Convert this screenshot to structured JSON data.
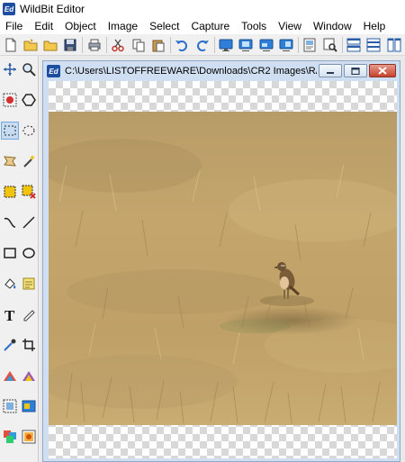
{
  "app": {
    "title": "WildBit Editor",
    "icon_text": "Ed"
  },
  "menu": [
    "File",
    "Edit",
    "Object",
    "Image",
    "Select",
    "Capture",
    "Tools",
    "View",
    "Window",
    "Help"
  ],
  "toolbar": {
    "buttons": [
      "new-icon",
      "open-icon",
      "open-folder-icon",
      "save-icon",
      "print-icon",
      "cut-icon",
      "copy-icon",
      "paste-icon",
      "undo-icon",
      "redo-icon",
      "monitor-icon",
      "monitor-window-icon",
      "monitor-region-icon",
      "monitor-object-icon",
      "properties-icon",
      "preview-icon",
      "tile-horizontal-icon",
      "tile-rows-icon",
      "tile-vertical-icon"
    ]
  },
  "toolbox": {
    "tools": [
      "move-icon",
      "zoom-icon",
      "red-eye-icon",
      "polygon-icon",
      "rect-select-icon",
      "ellipse-select-icon",
      "lasso-icon",
      "magic-wand-icon",
      "crop-select-icon",
      "clear-select-icon",
      "curve-icon",
      "line-icon",
      "rectangle-icon",
      "ellipse-icon",
      "fill-icon",
      "note-icon",
      "text-icon",
      "pencil-icon",
      "eyedropper-icon",
      "crop-icon",
      "adjust-icon",
      "sharpen-icon",
      "capture-region-icon",
      "screenshot-icon",
      "layers-icon",
      "gallery-icon"
    ],
    "selected": "rect-select-icon"
  },
  "document": {
    "title": "C:\\Users\\LISTOFFREEWARE\\Downloads\\CR2 Images\\RA...",
    "icon_text": "Ed"
  },
  "colors": {
    "accent": "#1e4ea0",
    "grass": "#c0a26a",
    "close_button": "#c6422c"
  }
}
